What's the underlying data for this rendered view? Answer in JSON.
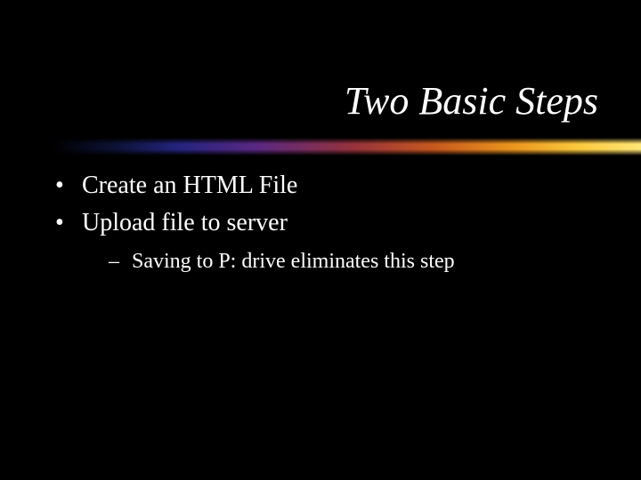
{
  "title": "Two Basic Steps",
  "bullets": {
    "item0": "Create an HTML File",
    "item1": "Upload file to server",
    "sub0": "Saving to P: drive eliminates this step"
  },
  "glyphs": {
    "bullet": "•",
    "dash": "–"
  }
}
